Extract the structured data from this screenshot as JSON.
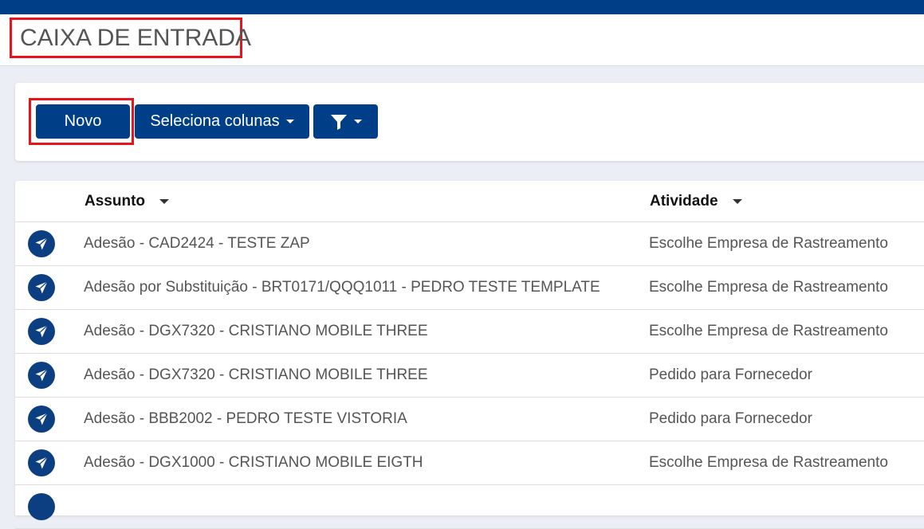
{
  "header": {
    "title": "CAIXA DE ENTRADA"
  },
  "toolbar": {
    "novo_label": "Novo",
    "columns_label": "Seleciona colunas",
    "filter_icon": "filter-icon"
  },
  "table": {
    "columns": [
      "Assunto",
      "Atividade"
    ],
    "rows": [
      {
        "icon": "paper-plane-icon",
        "assunto": "Adesão - CAD2424 - TESTE ZAP",
        "atividade": "Escolhe Empresa de Rastreamento"
      },
      {
        "icon": "paper-plane-icon",
        "assunto": "Adesão por Substituição - BRT0171/QQQ1011 - PEDRO TESTE TEMPLATE",
        "atividade": "Escolhe Empresa de Rastreamento"
      },
      {
        "icon": "paper-plane-icon",
        "assunto": "Adesão - DGX7320 - CRISTIANO MOBILE THREE",
        "atividade": "Escolhe Empresa de Rastreamento"
      },
      {
        "icon": "paper-plane-icon",
        "assunto": "Adesão - DGX7320 - CRISTIANO MOBILE THREE",
        "atividade": "Pedido para Fornecedor"
      },
      {
        "icon": "paper-plane-icon",
        "assunto": "Adesão - BBB2002 - PEDRO TESTE VISTORIA",
        "atividade": "Pedido para Fornecedor"
      },
      {
        "icon": "paper-plane-icon",
        "assunto": "Adesão - DGX1000 - CRISTIANO MOBILE EIGTH",
        "atividade": "Escolhe Empresa de Rastreamento"
      }
    ]
  },
  "colors": {
    "primary": "#003f87",
    "highlight": "#e8141c"
  }
}
